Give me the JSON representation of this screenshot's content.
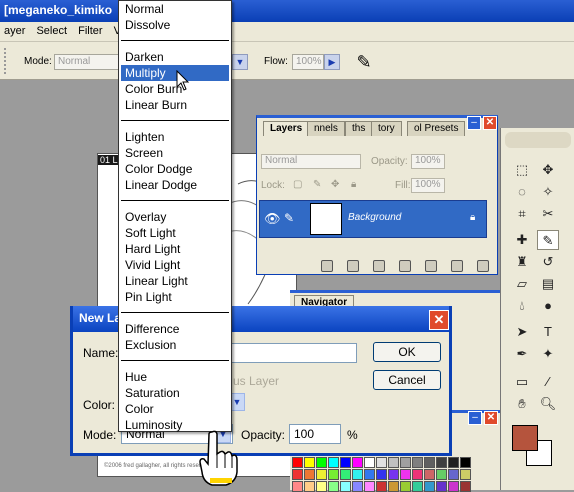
{
  "app": {
    "window_title": "[meganeko_kimiko",
    "menu": [
      "ayer",
      "Select",
      "Filter",
      "View"
    ]
  },
  "options_bar": {
    "mode_label": "Mode:",
    "mode_value": "Normal",
    "flow_label": "Flow:",
    "flow_value": "100%"
  },
  "document": {
    "tab_label": "01 L",
    "caption": "©2006 fred gallagher, all rights reserved"
  },
  "blend_modes": {
    "selected": "Multiply",
    "groups": [
      [
        "Normal",
        "Dissolve"
      ],
      [
        "Darken",
        "Multiply",
        "Color Burn",
        "Linear Burn"
      ],
      [
        "Lighten",
        "Screen",
        "Color Dodge",
        "Linear Dodge"
      ],
      [
        "Overlay",
        "Soft Light",
        "Hard Light",
        "Vivid Light",
        "Linear Light",
        "Pin Light"
      ],
      [
        "Difference",
        "Exclusion"
      ],
      [
        "Hue",
        "Saturation",
        "Color",
        "Luminosity"
      ]
    ]
  },
  "layers_palette": {
    "tabs": [
      "Layers",
      "nnels",
      "ths",
      "tory",
      "ol Presets"
    ],
    "blend_value": "Normal",
    "opacity_label": "Opacity:",
    "opacity_value": "100%",
    "lock_label": "Lock:",
    "fill_label": "Fill:",
    "fill_value": "100%",
    "layer_name": "Background"
  },
  "navigator": {
    "tab": "Navigator"
  },
  "swatches": {
    "colors": [
      "#ff0000",
      "#ffff00",
      "#00ff00",
      "#00ffff",
      "#0000ff",
      "#ff00ff",
      "#ffffff",
      "#e0e0e0",
      "#c0c0c0",
      "#a0a0a0",
      "#808080",
      "#606060",
      "#404040",
      "#202020",
      "#000000",
      "#ee3333",
      "#ee7733",
      "#eeee33",
      "#77ee33",
      "#33ee77",
      "#33eeee",
      "#3377ee",
      "#3333ee",
      "#7733ee",
      "#ee33ee",
      "#ee3377",
      "#cc6666",
      "#66cc66",
      "#6666cc",
      "#cccc66",
      "#ff8888",
      "#ffcc88",
      "#ffff88",
      "#88ff88",
      "#88ffff",
      "#8888ff",
      "#ff88ff",
      "#cc3333",
      "#cc9933",
      "#99cc33",
      "#33cc99",
      "#3399cc",
      "#6633cc",
      "#cc33cc",
      "#993333"
    ]
  },
  "toolbox": {
    "foreground_color": "#b5543d",
    "background_color": "#ffffff"
  },
  "dialog": {
    "title": "New La",
    "name_label": "Name:",
    "name_value": "",
    "group_text": "us Layer",
    "color_label": "Color:",
    "mode_label": "Mode:",
    "mode_value": "Normal",
    "opacity_label": "Opacity:",
    "opacity_value": "100",
    "percent": "%",
    "ok_label": "OK",
    "cancel_label": "Cancel"
  }
}
